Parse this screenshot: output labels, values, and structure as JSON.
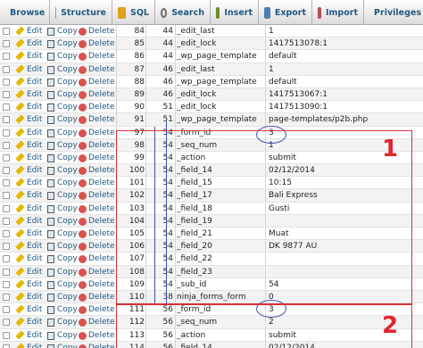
{
  "tabs": [
    {
      "label": "Browse",
      "icon": "browse-icon"
    },
    {
      "label": "Structure",
      "icon": "structure-icon"
    },
    {
      "label": "SQL",
      "icon": "sql-icon"
    },
    {
      "label": "Search",
      "icon": "search-icon"
    },
    {
      "label": "Insert",
      "icon": "insert-icon"
    },
    {
      "label": "Export",
      "icon": "export-icon"
    },
    {
      "label": "Import",
      "icon": "import-icon"
    },
    {
      "label": "Privileges",
      "icon": "privileges-icon"
    }
  ],
  "actions": {
    "edit": "Edit",
    "copy": "Copy",
    "delete": "Delete"
  },
  "rows": [
    {
      "id": "84",
      "post_id": "44",
      "meta_key": "_edit_last",
      "meta_value": "1"
    },
    {
      "id": "85",
      "post_id": "44",
      "meta_key": "_edit_lock",
      "meta_value": "1417513078:1"
    },
    {
      "id": "86",
      "post_id": "44",
      "meta_key": "_wp_page_template",
      "meta_value": "default"
    },
    {
      "id": "87",
      "post_id": "46",
      "meta_key": "_edit_last",
      "meta_value": "1"
    },
    {
      "id": "88",
      "post_id": "46",
      "meta_key": "_wp_page_template",
      "meta_value": "default"
    },
    {
      "id": "89",
      "post_id": "46",
      "meta_key": "_edit_lock",
      "meta_value": "1417513067:1"
    },
    {
      "id": "90",
      "post_id": "51",
      "meta_key": "_edit_lock",
      "meta_value": "1417513090:1"
    },
    {
      "id": "91",
      "post_id": "51",
      "meta_key": "_wp_page_template",
      "meta_value": "page-templates/p2b.php"
    },
    {
      "id": "97",
      "post_id": "54",
      "meta_key": "_form_id",
      "meta_value": "3"
    },
    {
      "id": "98",
      "post_id": "54",
      "meta_key": "_seq_num",
      "meta_value": "1"
    },
    {
      "id": "99",
      "post_id": "54",
      "meta_key": "_action",
      "meta_value": "submit"
    },
    {
      "id": "100",
      "post_id": "54",
      "meta_key": "_field_14",
      "meta_value": "02/12/2014"
    },
    {
      "id": "101",
      "post_id": "54",
      "meta_key": "_field_15",
      "meta_value": "10:15"
    },
    {
      "id": "102",
      "post_id": "54",
      "meta_key": "_field_17",
      "meta_value": "Bali Express"
    },
    {
      "id": "103",
      "post_id": "54",
      "meta_key": "_field_18",
      "meta_value": "Gusti"
    },
    {
      "id": "104",
      "post_id": "54",
      "meta_key": "_field_19",
      "meta_value": ""
    },
    {
      "id": "105",
      "post_id": "54",
      "meta_key": "_field_21",
      "meta_value": "Muat"
    },
    {
      "id": "106",
      "post_id": "54",
      "meta_key": "_field_20",
      "meta_value": "DK 9877 AU"
    },
    {
      "id": "107",
      "post_id": "54",
      "meta_key": "_field_22",
      "meta_value": ""
    },
    {
      "id": "108",
      "post_id": "54",
      "meta_key": "_field_23",
      "meta_value": ""
    },
    {
      "id": "109",
      "post_id": "54",
      "meta_key": "_sub_id",
      "meta_value": "54"
    },
    {
      "id": "110",
      "post_id": "38",
      "meta_key": "ninja_forms_form",
      "meta_value": "0"
    },
    {
      "id": "111",
      "post_id": "56",
      "meta_key": "_form_id",
      "meta_value": "3"
    },
    {
      "id": "112",
      "post_id": "56",
      "meta_key": "_seq_num",
      "meta_value": "2"
    },
    {
      "id": "113",
      "post_id": "56",
      "meta_key": "_action",
      "meta_value": "submit"
    },
    {
      "id": "114",
      "post_id": "56",
      "meta_key": "_field_14",
      "meta_value": "02/12/2014"
    }
  ],
  "annotations": {
    "group1_label": "1",
    "group2_label": "2"
  },
  "colors": {
    "annotation_red": "#d9303a",
    "annotation_blue": "#3c4fb0",
    "link": "#235a81"
  }
}
